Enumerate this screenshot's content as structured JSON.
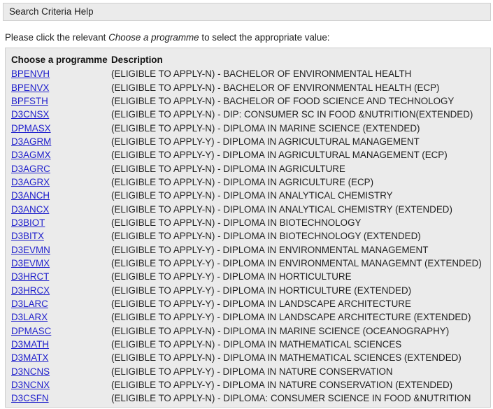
{
  "header": {
    "title": "Search Criteria Help"
  },
  "instructions": {
    "prefix": "Please click the relevant ",
    "emphasis": "Choose a programme",
    "suffix": " to select the appropriate value:"
  },
  "table": {
    "columns": [
      "Choose a programme",
      "Description"
    ],
    "rows": [
      {
        "code": "BPENVH",
        "description": "(ELIGIBLE TO APPLY-N) - BACHELOR OF ENVIRONMENTAL HEALTH"
      },
      {
        "code": "BPENVX",
        "description": "(ELIGIBLE TO APPLY-N) - BACHELOR OF ENVIRONMENTAL HEALTH (ECP)"
      },
      {
        "code": "BPFSTH",
        "description": "(ELIGIBLE TO APPLY-N) - BACHELOR OF FOOD SCIENCE AND TECHNOLOGY"
      },
      {
        "code": "D3CNSX",
        "description": "(ELIGIBLE TO APPLY-N) - DIP: CONSUMER SC IN FOOD &NUTRITION(EXTENDED)"
      },
      {
        "code": "DPMASX",
        "description": "(ELIGIBLE TO APPLY-N) - DIPLOMA IN MARINE SCIENCE (EXTENDED)"
      },
      {
        "code": "D3AGRM",
        "description": "(ELIGIBLE TO APPLY-Y) - DIPLOMA IN AGRICULTURAL MANAGEMENT"
      },
      {
        "code": "D3AGMX",
        "description": "(ELIGIBLE TO APPLY-Y) - DIPLOMA IN AGRICULTURAL MANAGEMENT (ECP)"
      },
      {
        "code": "D3AGRC",
        "description": "(ELIGIBLE TO APPLY-N) - DIPLOMA IN AGRICULTURE"
      },
      {
        "code": "D3AGRX",
        "description": "(ELIGIBLE TO APPLY-N) - DIPLOMA IN AGRICULTURE (ECP)"
      },
      {
        "code": "D3ANCH",
        "description": "(ELIGIBLE TO APPLY-N) - DIPLOMA IN ANALYTICAL CHEMISTRY"
      },
      {
        "code": "D3ANCX",
        "description": "(ELIGIBLE TO APPLY-N) - DIPLOMA IN ANALYTICAL CHEMISTRY (EXTENDED)"
      },
      {
        "code": "D3BIOT",
        "description": "(ELIGIBLE TO APPLY-N) - DIPLOMA IN BIOTECHNOLOGY"
      },
      {
        "code": "D3BITX",
        "description": "(ELIGIBLE TO APPLY-N) - DIPLOMA IN BIOTECHNOLOGY (EXTENDED)"
      },
      {
        "code": "D3EVMN",
        "description": "(ELIGIBLE TO APPLY-Y) - DIPLOMA IN ENVIRONMENTAL MANAGEMENT"
      },
      {
        "code": "D3EVMX",
        "description": "(ELIGIBLE TO APPLY-Y) - DIPLOMA IN ENVIRONMENTAL MANAGEMNT (EXTENDED)"
      },
      {
        "code": "D3HRCT",
        "description": "(ELIGIBLE TO APPLY-Y) - DIPLOMA IN HORTICULTURE"
      },
      {
        "code": "D3HRCX",
        "description": "(ELIGIBLE TO APPLY-Y) - DIPLOMA IN HORTICULTURE (EXTENDED)"
      },
      {
        "code": "D3LARC",
        "description": "(ELIGIBLE TO APPLY-Y) - DIPLOMA IN LANDSCAPE ARCHITECTURE"
      },
      {
        "code": "D3LARX",
        "description": "(ELIGIBLE TO APPLY-Y) - DIPLOMA IN LANDSCAPE ARCHITECTURE (EXTENDED)"
      },
      {
        "code": "DPMASC",
        "description": "(ELIGIBLE TO APPLY-N) - DIPLOMA IN MARINE SCIENCE (OCEANOGRAPHY)"
      },
      {
        "code": "D3MATH",
        "description": "(ELIGIBLE TO APPLY-N) - DIPLOMA IN MATHEMATICAL SCIENCES"
      },
      {
        "code": "D3MATX",
        "description": "(ELIGIBLE TO APPLY-N) - DIPLOMA IN MATHEMATICAL SCIENCES (EXTENDED)"
      },
      {
        "code": "D3NCNS",
        "description": "(ELIGIBLE TO APPLY-Y) - DIPLOMA IN NATURE CONSERVATION"
      },
      {
        "code": "D3NCNX",
        "description": "(ELIGIBLE TO APPLY-Y) - DIPLOMA IN NATURE CONSERVATION (EXTENDED)"
      },
      {
        "code": "D3CSFN",
        "description": "(ELIGIBLE TO APPLY-N) - DIPLOMA: CONSUMER SCIENCE IN FOOD &NUTRITION"
      }
    ]
  }
}
